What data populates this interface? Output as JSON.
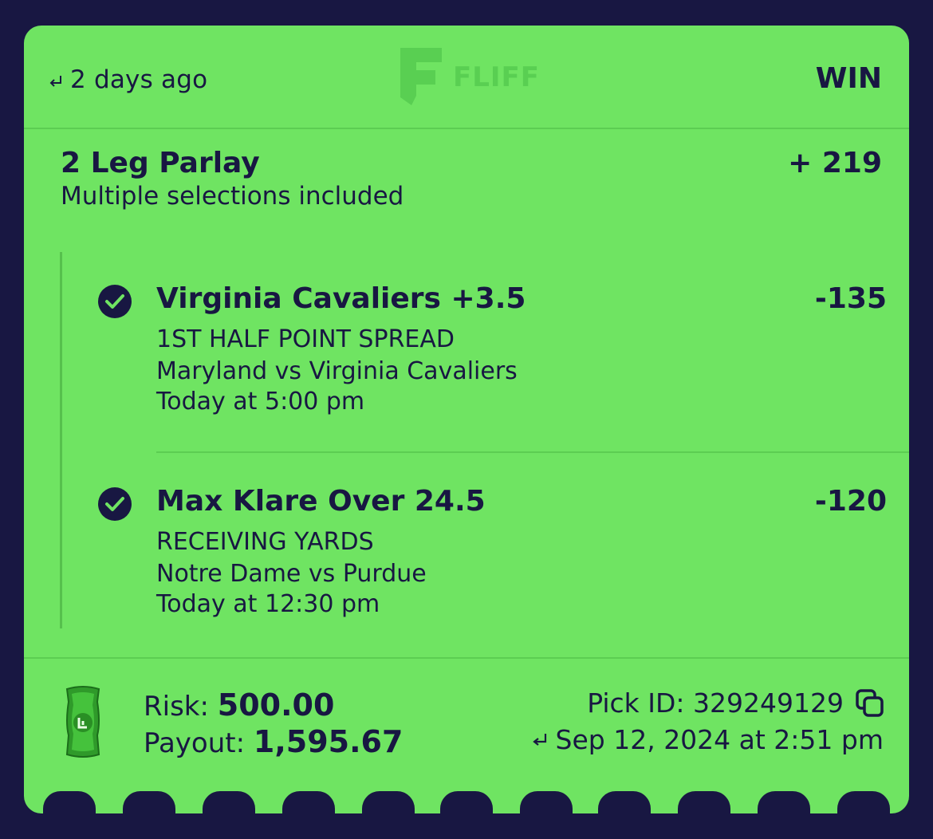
{
  "header": {
    "time_ago": "2 days ago",
    "logo_text": "FLIFF",
    "status": "WIN"
  },
  "parlay": {
    "title": "2 Leg Parlay",
    "subtitle": "Multiple selections included",
    "odds": "+ 219"
  },
  "legs": [
    {
      "title": "Virginia Cavaliers +3.5",
      "odds": "-135",
      "market": "1ST HALF POINT SPREAD",
      "matchup": "Maryland vs Virginia Cavaliers",
      "time": "Today at 5:00 pm"
    },
    {
      "title": "Max Klare Over 24.5",
      "odds": "-120",
      "market": "RECEIVING YARDS",
      "matchup": "Notre Dame vs Purdue",
      "time": "Today at 12:30 pm"
    }
  ],
  "footer": {
    "risk_label": "Risk:",
    "risk_value": "500.00",
    "payout_label": "Payout:",
    "payout_value": "1,595.67",
    "pick_id": "Pick ID: 329249129",
    "placed_at": "Sep 12, 2024 at 2:51 pm"
  },
  "icons": {
    "return": "return-arrow-icon",
    "check": "check-circle-icon",
    "copy": "copy-icon",
    "cash": "cash-icon",
    "logo": "fliff-logo-icon"
  },
  "colors": {
    "ticket_background": "#6fe462",
    "page_background": "#181742",
    "text": "#181742",
    "logo": "#4cc24a"
  }
}
